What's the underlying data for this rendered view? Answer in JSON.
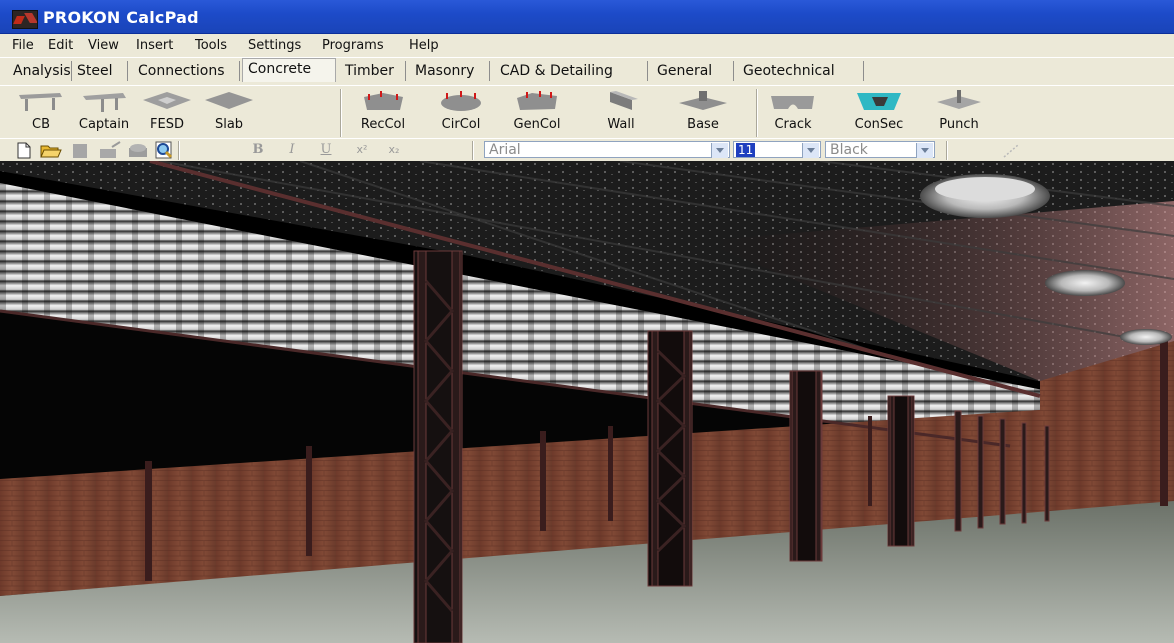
{
  "window": {
    "title": "PROKON CalcPad",
    "icon": "prokon-app-icon"
  },
  "menu": [
    "File",
    "Edit",
    "View",
    "Insert",
    "Tools",
    "Settings",
    "Programs",
    "Help"
  ],
  "tabs": [
    {
      "label": "Analysis",
      "active": false
    },
    {
      "label": "Steel",
      "active": false
    },
    {
      "label": "Connections",
      "active": false
    },
    {
      "label": "Concrete",
      "active": true
    },
    {
      "label": "Timber",
      "active": false
    },
    {
      "label": "Masonry",
      "active": false
    },
    {
      "label": "CAD & Detailing",
      "active": false
    },
    {
      "label": "General",
      "active": false
    },
    {
      "label": "Geotechnical",
      "active": false
    }
  ],
  "toolbar": {
    "buttons": [
      {
        "label": "CB",
        "icon": "continuous-beam-icon"
      },
      {
        "label": "Captain",
        "icon": "captain-beam-icon"
      },
      {
        "label": "FESD",
        "icon": "flat-slab-icon"
      },
      {
        "label": "Slab",
        "icon": "slab-icon"
      },
      {
        "label": "RecCol",
        "icon": "rectangular-column-icon"
      },
      {
        "label": "CirCol",
        "icon": "circular-column-icon"
      },
      {
        "label": "GenCol",
        "icon": "general-column-icon"
      },
      {
        "label": "Wall",
        "icon": "wall-icon"
      },
      {
        "label": "Base",
        "icon": "base-footing-icon"
      },
      {
        "label": "Crack",
        "icon": "crack-width-icon"
      },
      {
        "label": "ConSec",
        "icon": "concrete-section-icon"
      },
      {
        "label": "Punch",
        "icon": "punching-shear-icon"
      }
    ]
  },
  "format_bar": {
    "font_name": "Arial",
    "font_size": "11",
    "color": "Black",
    "bold": "B",
    "italic": "I",
    "underline": "U",
    "superscript": "x²",
    "subscript": "x₂"
  },
  "scene": {
    "subject": "warehouse-interior-3d-render"
  }
}
